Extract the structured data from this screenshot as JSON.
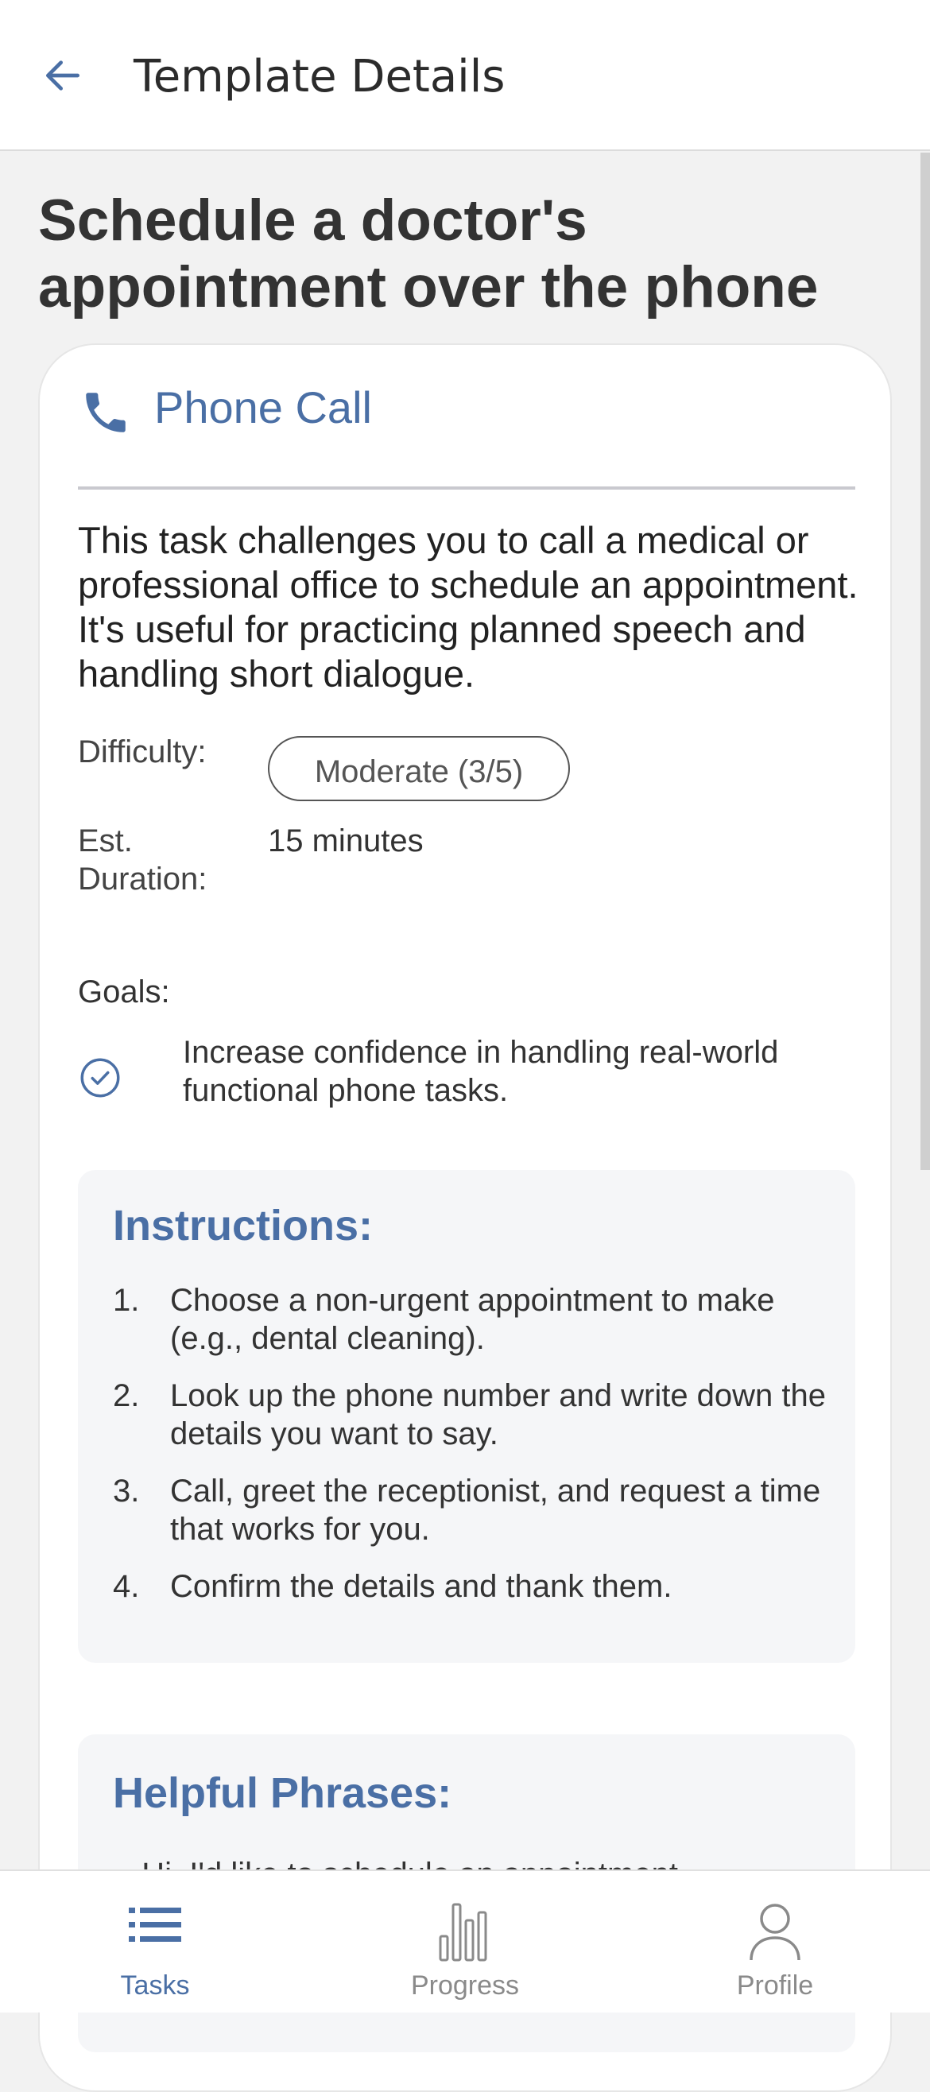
{
  "header": {
    "title": "Template Details",
    "back_icon": "arrow-left-icon"
  },
  "task": {
    "title": "Schedule a doctor's appointment over the phone",
    "category": "Phone Call",
    "category_icon": "phone-icon",
    "description": "This task challenges you to call a medical or professional office to schedule an appointment. It's useful for practicing planned speech and handling short dialogue.",
    "difficulty_label": "Difficulty:",
    "difficulty_value": "Moderate (3/5)",
    "duration_label_line1": "Est.",
    "duration_label_line2": "Duration:",
    "duration_value": "15 minutes",
    "goals_label": "Goals:",
    "goals": [
      "Increase confidence in handling real-world functional phone tasks."
    ]
  },
  "instructions": {
    "title": "Instructions:",
    "items": [
      {
        "num": "1.",
        "text": "Choose a non-urgent appointment to make (e.g., dental cleaning)."
      },
      {
        "num": "2.",
        "text": "Look up the phone number and write down the details you want to say."
      },
      {
        "num": "3.",
        "text": "Call, greet the receptionist, and request a time that works for you."
      },
      {
        "num": "4.",
        "text": "Confirm the details and thank them."
      }
    ]
  },
  "phrases": {
    "title": "Helpful Phrases:",
    "items": [
      "Hi, I'd like to schedule an appointment"
    ]
  },
  "nav": {
    "items": [
      {
        "label": "Tasks",
        "icon": "list-icon",
        "active": true
      },
      {
        "label": "Progress",
        "icon": "bar-chart-icon",
        "active": false
      },
      {
        "label": "Profile",
        "icon": "person-icon",
        "active": false
      }
    ]
  },
  "colors": {
    "accent": "#4a6fa5",
    "background": "#f2f2f2",
    "card": "#ffffff",
    "section_bg": "#f5f6f8"
  }
}
